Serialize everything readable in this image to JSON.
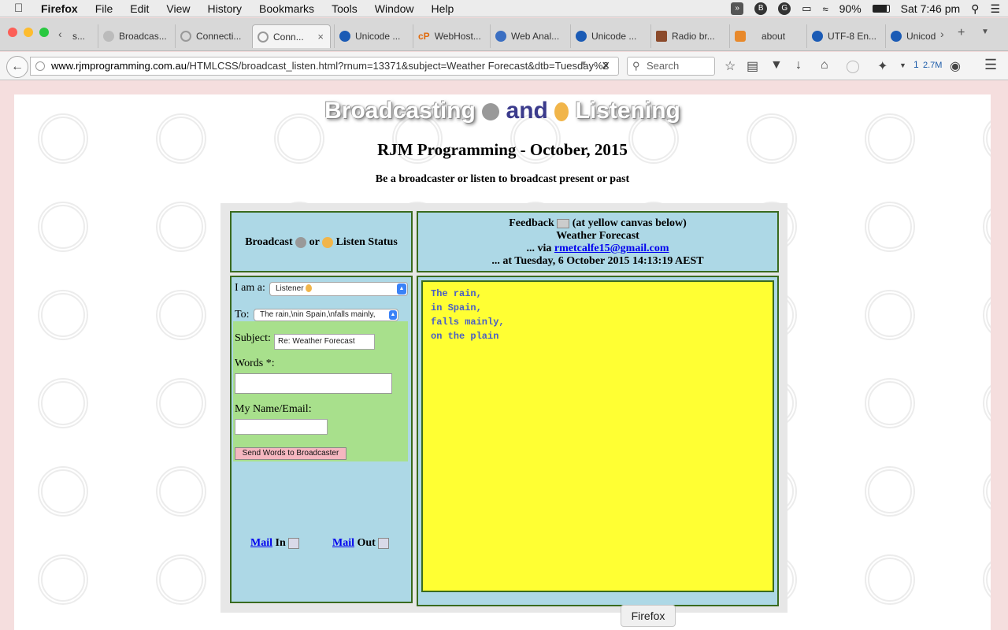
{
  "menubar": {
    "items": [
      "Firefox",
      "File",
      "Edit",
      "View",
      "History",
      "Bookmarks",
      "Tools",
      "Window",
      "Help"
    ],
    "battery": "90%",
    "clock": "Sat 7:46 pm"
  },
  "tabs": [
    {
      "label": "s..."
    },
    {
      "label": "Broadcas..."
    },
    {
      "label": "Connecti..."
    },
    {
      "label": "Conn..."
    },
    {
      "label": "Unicode ..."
    },
    {
      "label": "WebHost..."
    },
    {
      "label": "Web Anal..."
    },
    {
      "label": "Unicode ..."
    },
    {
      "label": "Radio br..."
    },
    {
      "label": "about"
    },
    {
      "label": "UTF-8 En..."
    },
    {
      "label": "Unicod"
    }
  ],
  "nav": {
    "url_domain": "www.rjmprogramming.com.au",
    "url_path": "/HTMLCSS/broadcast_listen.html?rnum=13371&subject=Weather Forecast&dtb=Tuesday%2",
    "search_placeholder": "Search",
    "download_count": "1",
    "download_size": "2.7M"
  },
  "page": {
    "title_left": "Broadcasting",
    "title_and": "and",
    "title_right": "Listening",
    "subtitle": "RJM Programming - October, 2015",
    "tagline": "Be a broadcaster or listen to broadcast present or past",
    "status_head_a": "Broadcast",
    "status_head_or": "or",
    "status_head_b": "Listen Status",
    "feedback_line1": "Feedback",
    "feedback_line1b": "(at yellow canvas below)",
    "feedback_subject": "Weather Forecast",
    "feedback_via": "... via",
    "feedback_email": "rmetcalfe15@gmail.com",
    "feedback_at": "... at Tuesday, 6 October 2015 14:13:19 AEST"
  },
  "form": {
    "iam_label": "I am a:",
    "iam_value": "Listener",
    "to_label": "To:",
    "to_value": "The rain,\\nin Spain,\\nfalls mainly,",
    "subject_label": "Subject:",
    "subject_value": "Re: Weather Forecast",
    "words_label": "Words *:",
    "name_label": "My Name/Email:",
    "send_label": "Send Words to Broadcaster",
    "mail_in_link": "Mail",
    "mail_in_text": "In",
    "mail_out_link": "Mail",
    "mail_out_text": "Out"
  },
  "canvas_lines": [
    "The rain,",
    "in Spain,",
    "falls mainly,",
    "on the plain"
  ],
  "tooltip": "Firefox"
}
